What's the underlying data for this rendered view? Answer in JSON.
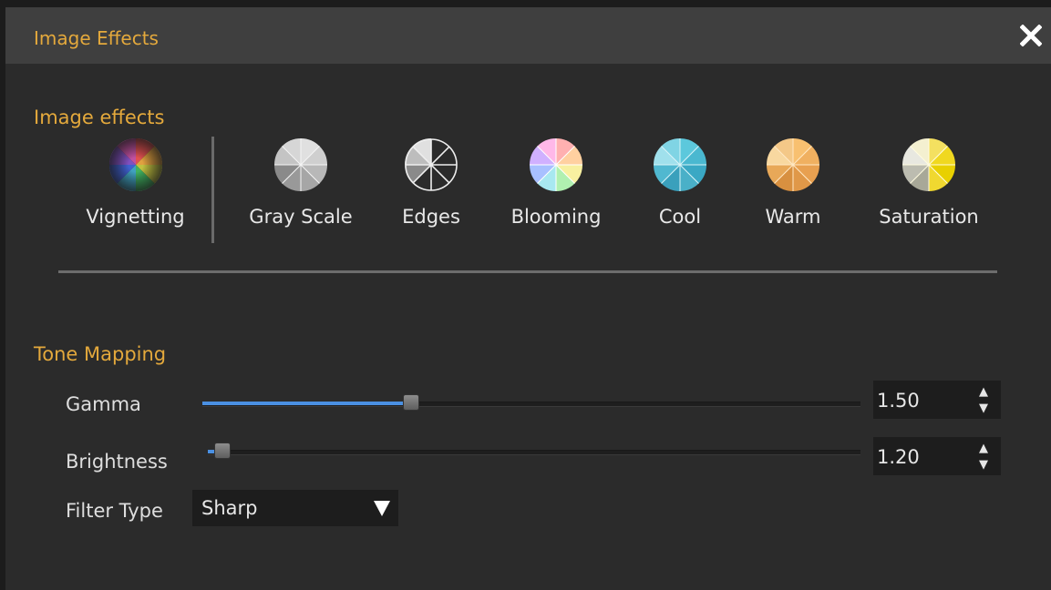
{
  "window": {
    "title": "Image Effects"
  },
  "effects_section": {
    "heading": "Image effects",
    "items": [
      {
        "label": "Vignetting",
        "icon": "vignetting-wheel-icon"
      },
      {
        "label": "Gray Scale",
        "icon": "grayscale-wheel-icon"
      },
      {
        "label": "Edges",
        "icon": "edges-wheel-icon"
      },
      {
        "label": "Blooming",
        "icon": "blooming-wheel-icon"
      },
      {
        "label": "Cool",
        "icon": "cool-wheel-icon"
      },
      {
        "label": "Warm",
        "icon": "warm-wheel-icon"
      },
      {
        "label": "Saturation",
        "icon": "saturation-wheel-icon"
      }
    ]
  },
  "tone_mapping": {
    "heading": "Tone Mapping",
    "gamma": {
      "label": "Gamma",
      "value": "1.50",
      "slider_fraction": 0.305
    },
    "brightness": {
      "label": "Brightness",
      "value": "1.20",
      "slider_fraction": 0.01
    },
    "filter_type": {
      "label": "Filter Type",
      "value": "Sharp"
    }
  },
  "colors": {
    "accent": "#e4a93c",
    "slider_fill": "#4a90e2",
    "background": "#2b2b2b",
    "titlebar": "#3f3f3f"
  }
}
